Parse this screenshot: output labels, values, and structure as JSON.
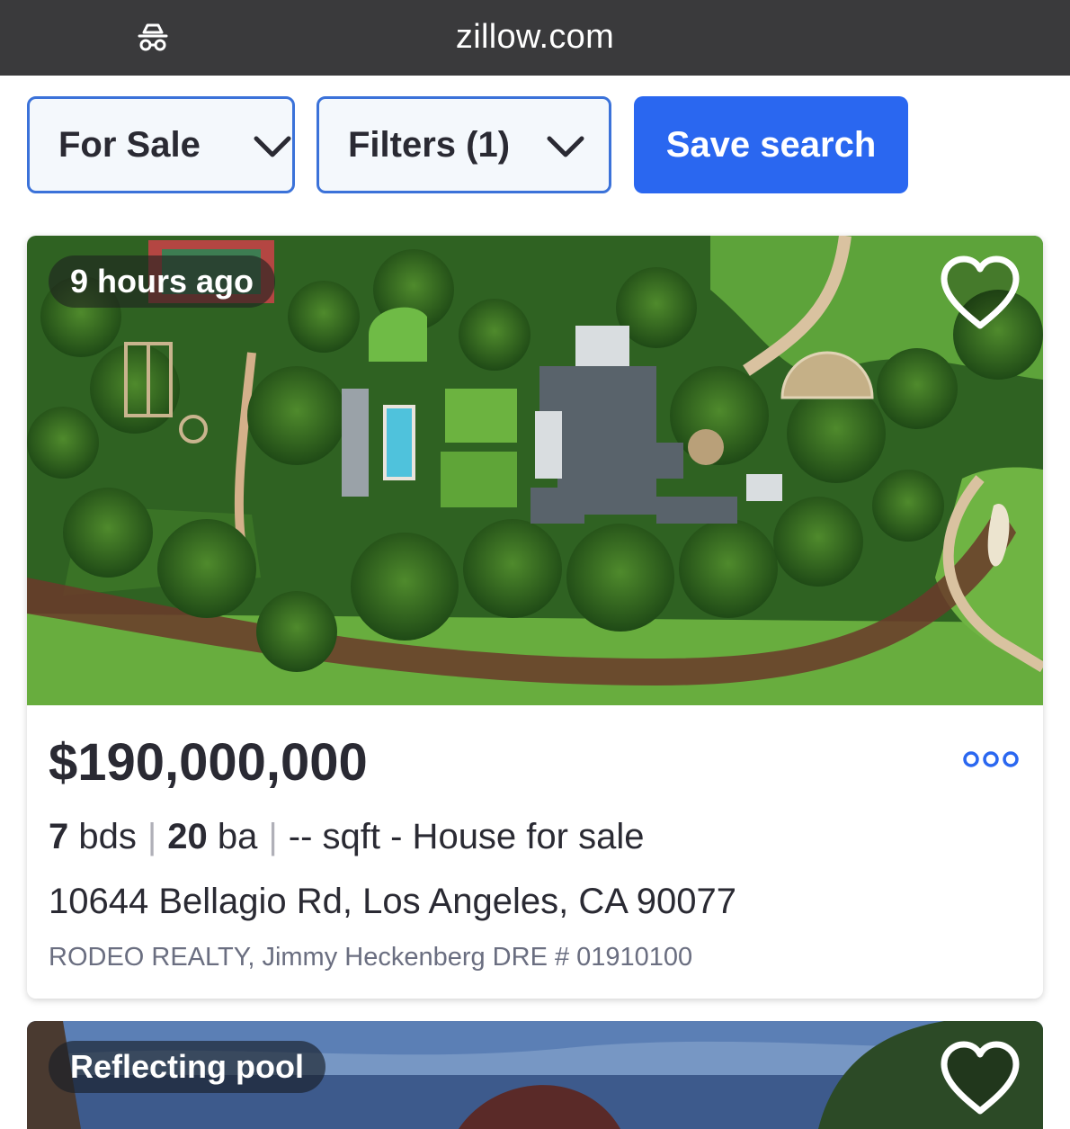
{
  "browser": {
    "url": "zillow.com",
    "incognito_icon": "incognito-icon"
  },
  "controls": {
    "for_sale_label": "For Sale",
    "filters_label": "Filters (1)",
    "save_search_label": "Save search",
    "accent_color": "#2a67f0"
  },
  "listings": [
    {
      "badge": "9 hours ago",
      "price": "$190,000,000",
      "beds_value": "7",
      "beds_unit": "bds",
      "baths_value": "20",
      "baths_unit": "ba",
      "sqft_and_type": "-- sqft - House for sale",
      "address": "10644 Bellagio Rd, Los Angeles, CA 90077",
      "broker": "RODEO REALTY, Jimmy Heckenberg DRE # 01910100",
      "favorite_icon": "heart-outline-icon",
      "more_icon": "more-options-icon"
    },
    {
      "badge": "Reflecting pool",
      "favorite_icon": "heart-outline-icon"
    }
  ]
}
